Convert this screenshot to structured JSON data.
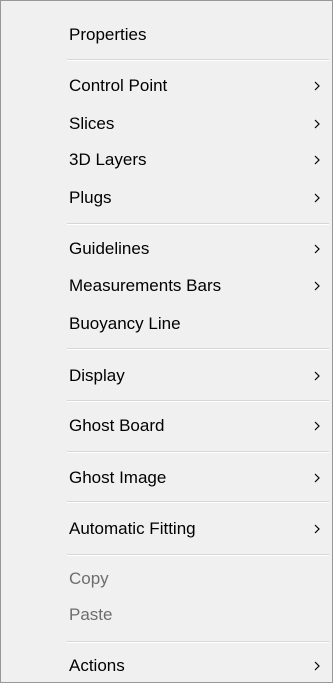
{
  "menu": {
    "items": [
      {
        "label": "Properties",
        "submenu": false,
        "enabled": true
      },
      {
        "label": "Control Point",
        "submenu": true,
        "enabled": true
      },
      {
        "label": "Slices",
        "submenu": true,
        "enabled": true
      },
      {
        "label": "3D Layers",
        "submenu": true,
        "enabled": true
      },
      {
        "label": "Plugs",
        "submenu": true,
        "enabled": true
      },
      {
        "label": "Guidelines",
        "submenu": true,
        "enabled": true
      },
      {
        "label": "Measurements Bars",
        "submenu": true,
        "enabled": true
      },
      {
        "label": "Buoyancy Line",
        "submenu": false,
        "enabled": true
      },
      {
        "label": "Display",
        "submenu": true,
        "enabled": true
      },
      {
        "label": "Ghost Board",
        "submenu": true,
        "enabled": true
      },
      {
        "label": "Ghost Image",
        "submenu": true,
        "enabled": true
      },
      {
        "label": "Automatic Fitting",
        "submenu": true,
        "enabled": true
      },
      {
        "label": "Copy",
        "submenu": false,
        "enabled": false
      },
      {
        "label": "Paste",
        "submenu": false,
        "enabled": false
      },
      {
        "label": "Actions",
        "submenu": true,
        "enabled": true
      }
    ],
    "submenu_icon": "chevron-right-icon",
    "colors": {
      "background": "#f0f0f0",
      "border": "#979797",
      "separator": "#d7d7d7",
      "text": "#000000",
      "disabled_text": "#6d6d6d"
    }
  }
}
